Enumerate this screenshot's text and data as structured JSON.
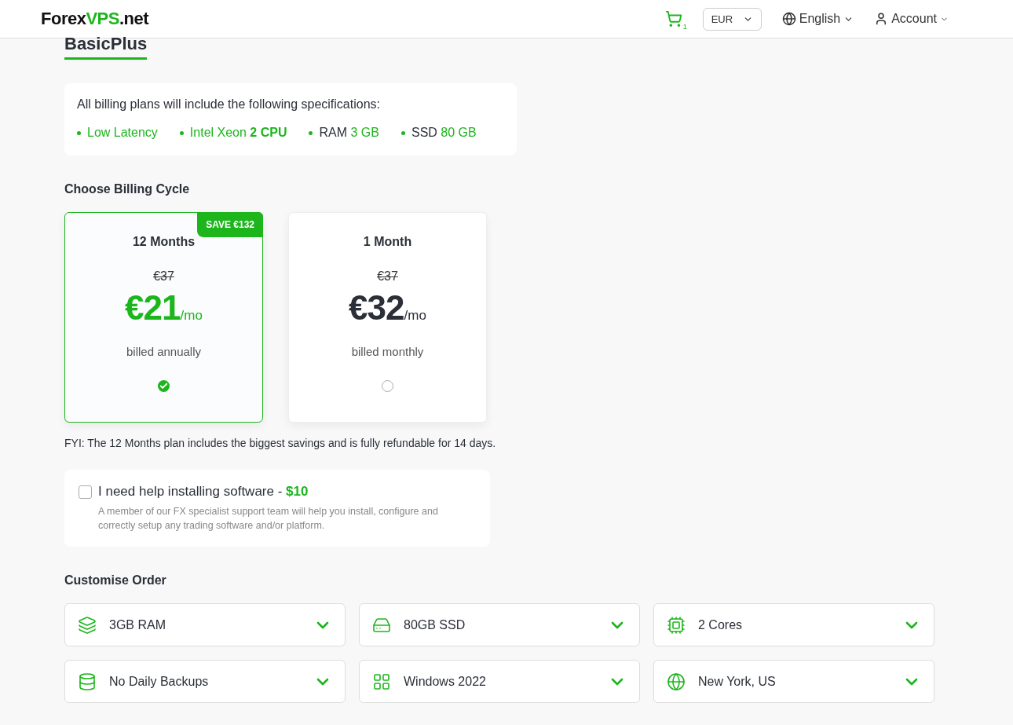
{
  "header": {
    "logo": {
      "brand": "Forex",
      "highlight": "VPS",
      "suffix": ".net"
    },
    "cart_count": "1",
    "currency": "EUR",
    "language": "English",
    "account": "Account"
  },
  "plan_title": "BasicPlus",
  "specs": {
    "intro": "All billing plans will include the following specifications:",
    "items": [
      {
        "kind": "feature",
        "text": "Low Latency"
      },
      {
        "kind": "feature",
        "text": "Intel Xeon **2 CPU**"
      },
      {
        "kind": "spec",
        "label": "RAM",
        "value": "3 GB"
      },
      {
        "kind": "spec",
        "label": "SSD",
        "value": "80 GB"
      }
    ]
  },
  "billing": {
    "heading": "Choose Billing Cycle",
    "cycles": [
      {
        "title": "12 Months",
        "badge": "SAVE €132",
        "old_price": "€37",
        "price": "€21",
        "unit": "/mo",
        "note": "billed annually",
        "selected": true
      },
      {
        "title": "1 Month",
        "old_price": "€37",
        "price": "€32",
        "unit": "/mo",
        "note": "billed monthly",
        "selected": false
      }
    ],
    "fyi": "FYI: The 12 Months plan includes the biggest savings and is fully refundable for 14 days."
  },
  "addon": {
    "checked": false,
    "title": "I need help installing software - ",
    "price": "$10",
    "description": "A member of our FX specialist support team will help you install, configure and correctly setup any trading software and/or platform."
  },
  "customise": {
    "heading": "Customise Order",
    "options": [
      {
        "kind": "ram",
        "label": "3GB RAM"
      },
      {
        "kind": "disk",
        "label": "80GB SSD"
      },
      {
        "kind": "cpu",
        "label": "2 Cores"
      },
      {
        "kind": "backup",
        "label": "No Daily Backups"
      },
      {
        "kind": "os",
        "label": "Windows 2022"
      },
      {
        "kind": "location",
        "label": "New York, US"
      }
    ]
  }
}
